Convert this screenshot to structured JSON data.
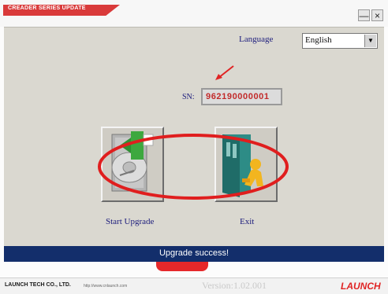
{
  "window": {
    "title": "CREADER SERIES UPDATE",
    "minimize_glyph": "—",
    "close_glyph": "×"
  },
  "language": {
    "label": "Language",
    "selected": "English",
    "dropdown_icon": "chevron-down-icon"
  },
  "serial": {
    "label": "SN:",
    "value": "962190000001"
  },
  "actions": {
    "upgrade_label": "Start Upgrade",
    "exit_label": "Exit"
  },
  "status": {
    "message": "Upgrade success!"
  },
  "footer": {
    "company": "LAUNCH TECH CO., LTD.",
    "website": "http://www.cnlaunch.com",
    "version": "Version:1.02.001",
    "brand": "LAUNCH"
  },
  "colors": {
    "accent_red": "#e02424",
    "status_bar": "#132e6b",
    "panel": "#dad8d0"
  }
}
